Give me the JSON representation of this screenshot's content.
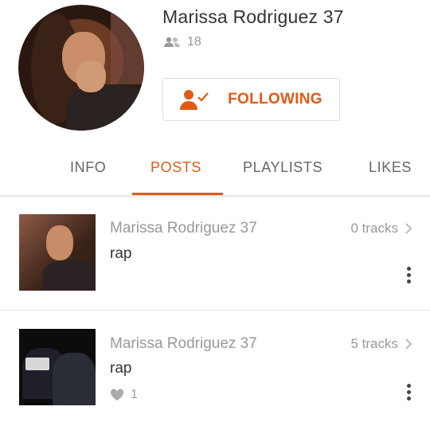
{
  "profile": {
    "username": "Marissa Rodriguez 37",
    "followers_count": "18",
    "follow_button_label": "FOLLOWING"
  },
  "tabs": [
    {
      "label": "INFO",
      "active": false
    },
    {
      "label": "POSTS",
      "active": true
    },
    {
      "label": "PLAYLISTS",
      "active": false
    },
    {
      "label": "LIKES",
      "active": false
    }
  ],
  "posts": [
    {
      "owner": "Marissa Rodriguez 37",
      "title": "rap",
      "tracks": "0 tracks",
      "likes": ""
    },
    {
      "owner": "Marissa Rodriguez 37",
      "title": "rap",
      "tracks": "5 tracks",
      "likes": "1"
    }
  ],
  "colors": {
    "accent": "#e05a13",
    "muted": "#999999",
    "text": "#333333"
  },
  "icons": [
    "followers-icon",
    "following-user-check-icon",
    "chevron-right-icon",
    "heart-icon",
    "more-vertical-icon"
  ]
}
